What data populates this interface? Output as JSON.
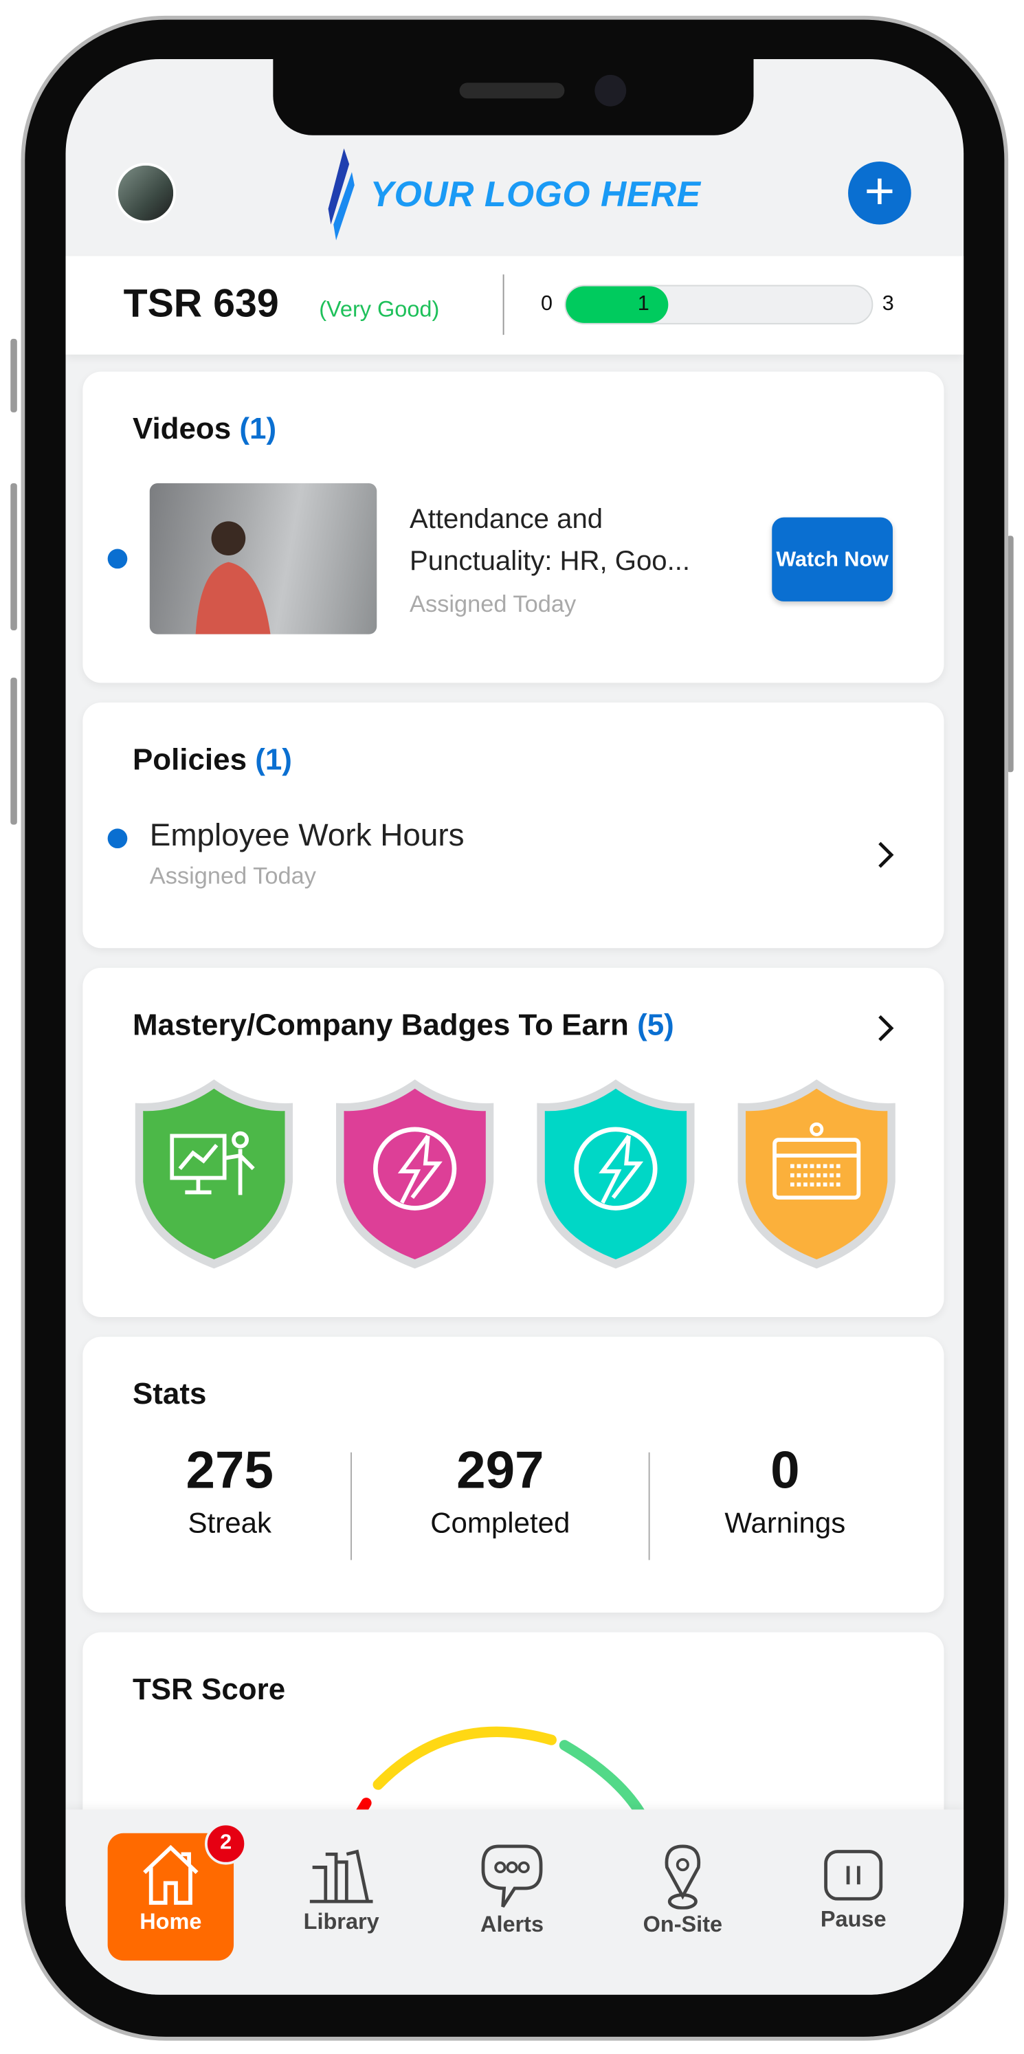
{
  "header": {
    "logo_text": "YOUR LOGO HERE",
    "add_icon": "plus-icon"
  },
  "tsr": {
    "title": "TSR 639",
    "rating": "(Very Good)",
    "progress": {
      "min": "0",
      "value": "1",
      "max": "3",
      "fraction": 0.333
    },
    "rating_color": "#1ec05a",
    "fill_color": "#00cb5e"
  },
  "videos": {
    "title": "Videos",
    "count": "(1)",
    "item": {
      "title": "Attendance and Punctuality: HR, Goo...",
      "subtitle": "Assigned Today",
      "button": "Watch Now"
    }
  },
  "policies": {
    "title": "Policies",
    "count": "(1)",
    "item": {
      "title": "Employee Work Hours",
      "subtitle": "Assigned Today"
    }
  },
  "badges": {
    "title": "Mastery/Company Badges To Earn",
    "count": "(5)",
    "items": [
      {
        "icon": "presentation-icon",
        "color": "#4cb848"
      },
      {
        "icon": "lightning-icon",
        "color": "#dd3f97"
      },
      {
        "icon": "lightning-icon",
        "color": "#00d7c6"
      },
      {
        "icon": "calendar-icon",
        "color": "#fbb03b"
      }
    ]
  },
  "stats": {
    "title": "Stats",
    "items": [
      {
        "value": "275",
        "label": "Streak"
      },
      {
        "value": "297",
        "label": "Completed"
      },
      {
        "value": "0",
        "label": "Warnings"
      }
    ]
  },
  "tsr_score": {
    "title": "TSR Score"
  },
  "nav": {
    "items": [
      {
        "label": "Home",
        "badge": "2"
      },
      {
        "label": "Library"
      },
      {
        "label": "Alerts"
      },
      {
        "label": "On-Site"
      },
      {
        "label": "Pause"
      }
    ]
  },
  "colors": {
    "accent": "#0a6fd1",
    "home_active": "#ff6a00"
  }
}
